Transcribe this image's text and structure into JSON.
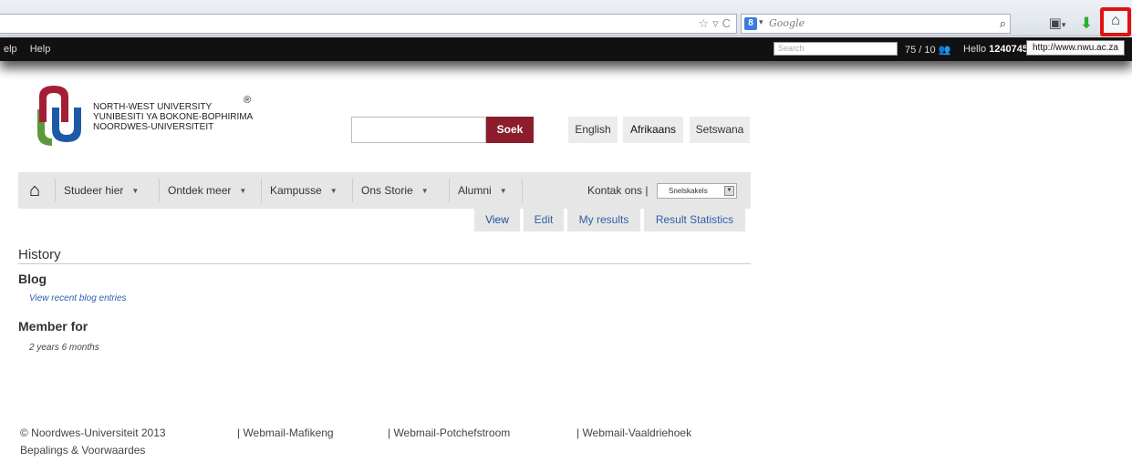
{
  "browser": {
    "search_engine_placeholder": "Google",
    "engine_badge": "8",
    "tooltip": "http://www.nwu.ac.za"
  },
  "admin_bar": {
    "menu": [
      "elp",
      "Help"
    ],
    "search_placeholder": "Search",
    "stats": "75 / 10",
    "hello_prefix": "Hello",
    "user_id": "1240745"
  },
  "header": {
    "logo_lines": [
      "NORTH-WEST UNIVERSITY",
      "YUNIBESITI YA BOKONE-BOPHIRIMA",
      "NOORDWES-UNIVERSITEIT"
    ],
    "registered_mark": "®",
    "search_button": "Soek",
    "languages": [
      "English",
      "Afrikaans",
      "Setswana"
    ]
  },
  "nav": {
    "items": [
      "Studeer hier",
      "Ontdek meer",
      "Kampusse",
      "Ons Storie",
      "Alumni"
    ],
    "contact": "Kontak ons |",
    "quicklinks": "Snelskakels"
  },
  "tabs": [
    "View",
    "Edit",
    "My results",
    "Result Statistics"
  ],
  "content": {
    "page_title": "History",
    "blog_heading": "Blog",
    "blog_link": "View recent blog entries",
    "member_heading": "Member for",
    "member_value": "2 years 6 months"
  },
  "footer": {
    "copyright": "© Noordwes-Universiteit 2013",
    "terms": "Bepalings & Voorwaardes",
    "webmail": [
      "| Webmail-Mafikeng",
      "| Webmail-Potchefstroom",
      "| Webmail-Vaaldriehoek"
    ]
  },
  "colors": {
    "soek_button": "#8b1d2c",
    "logo_red": "#a41f35",
    "logo_blue": "#1d5aa6",
    "logo_green": "#5a9a3c",
    "highlight": "#e01212"
  }
}
